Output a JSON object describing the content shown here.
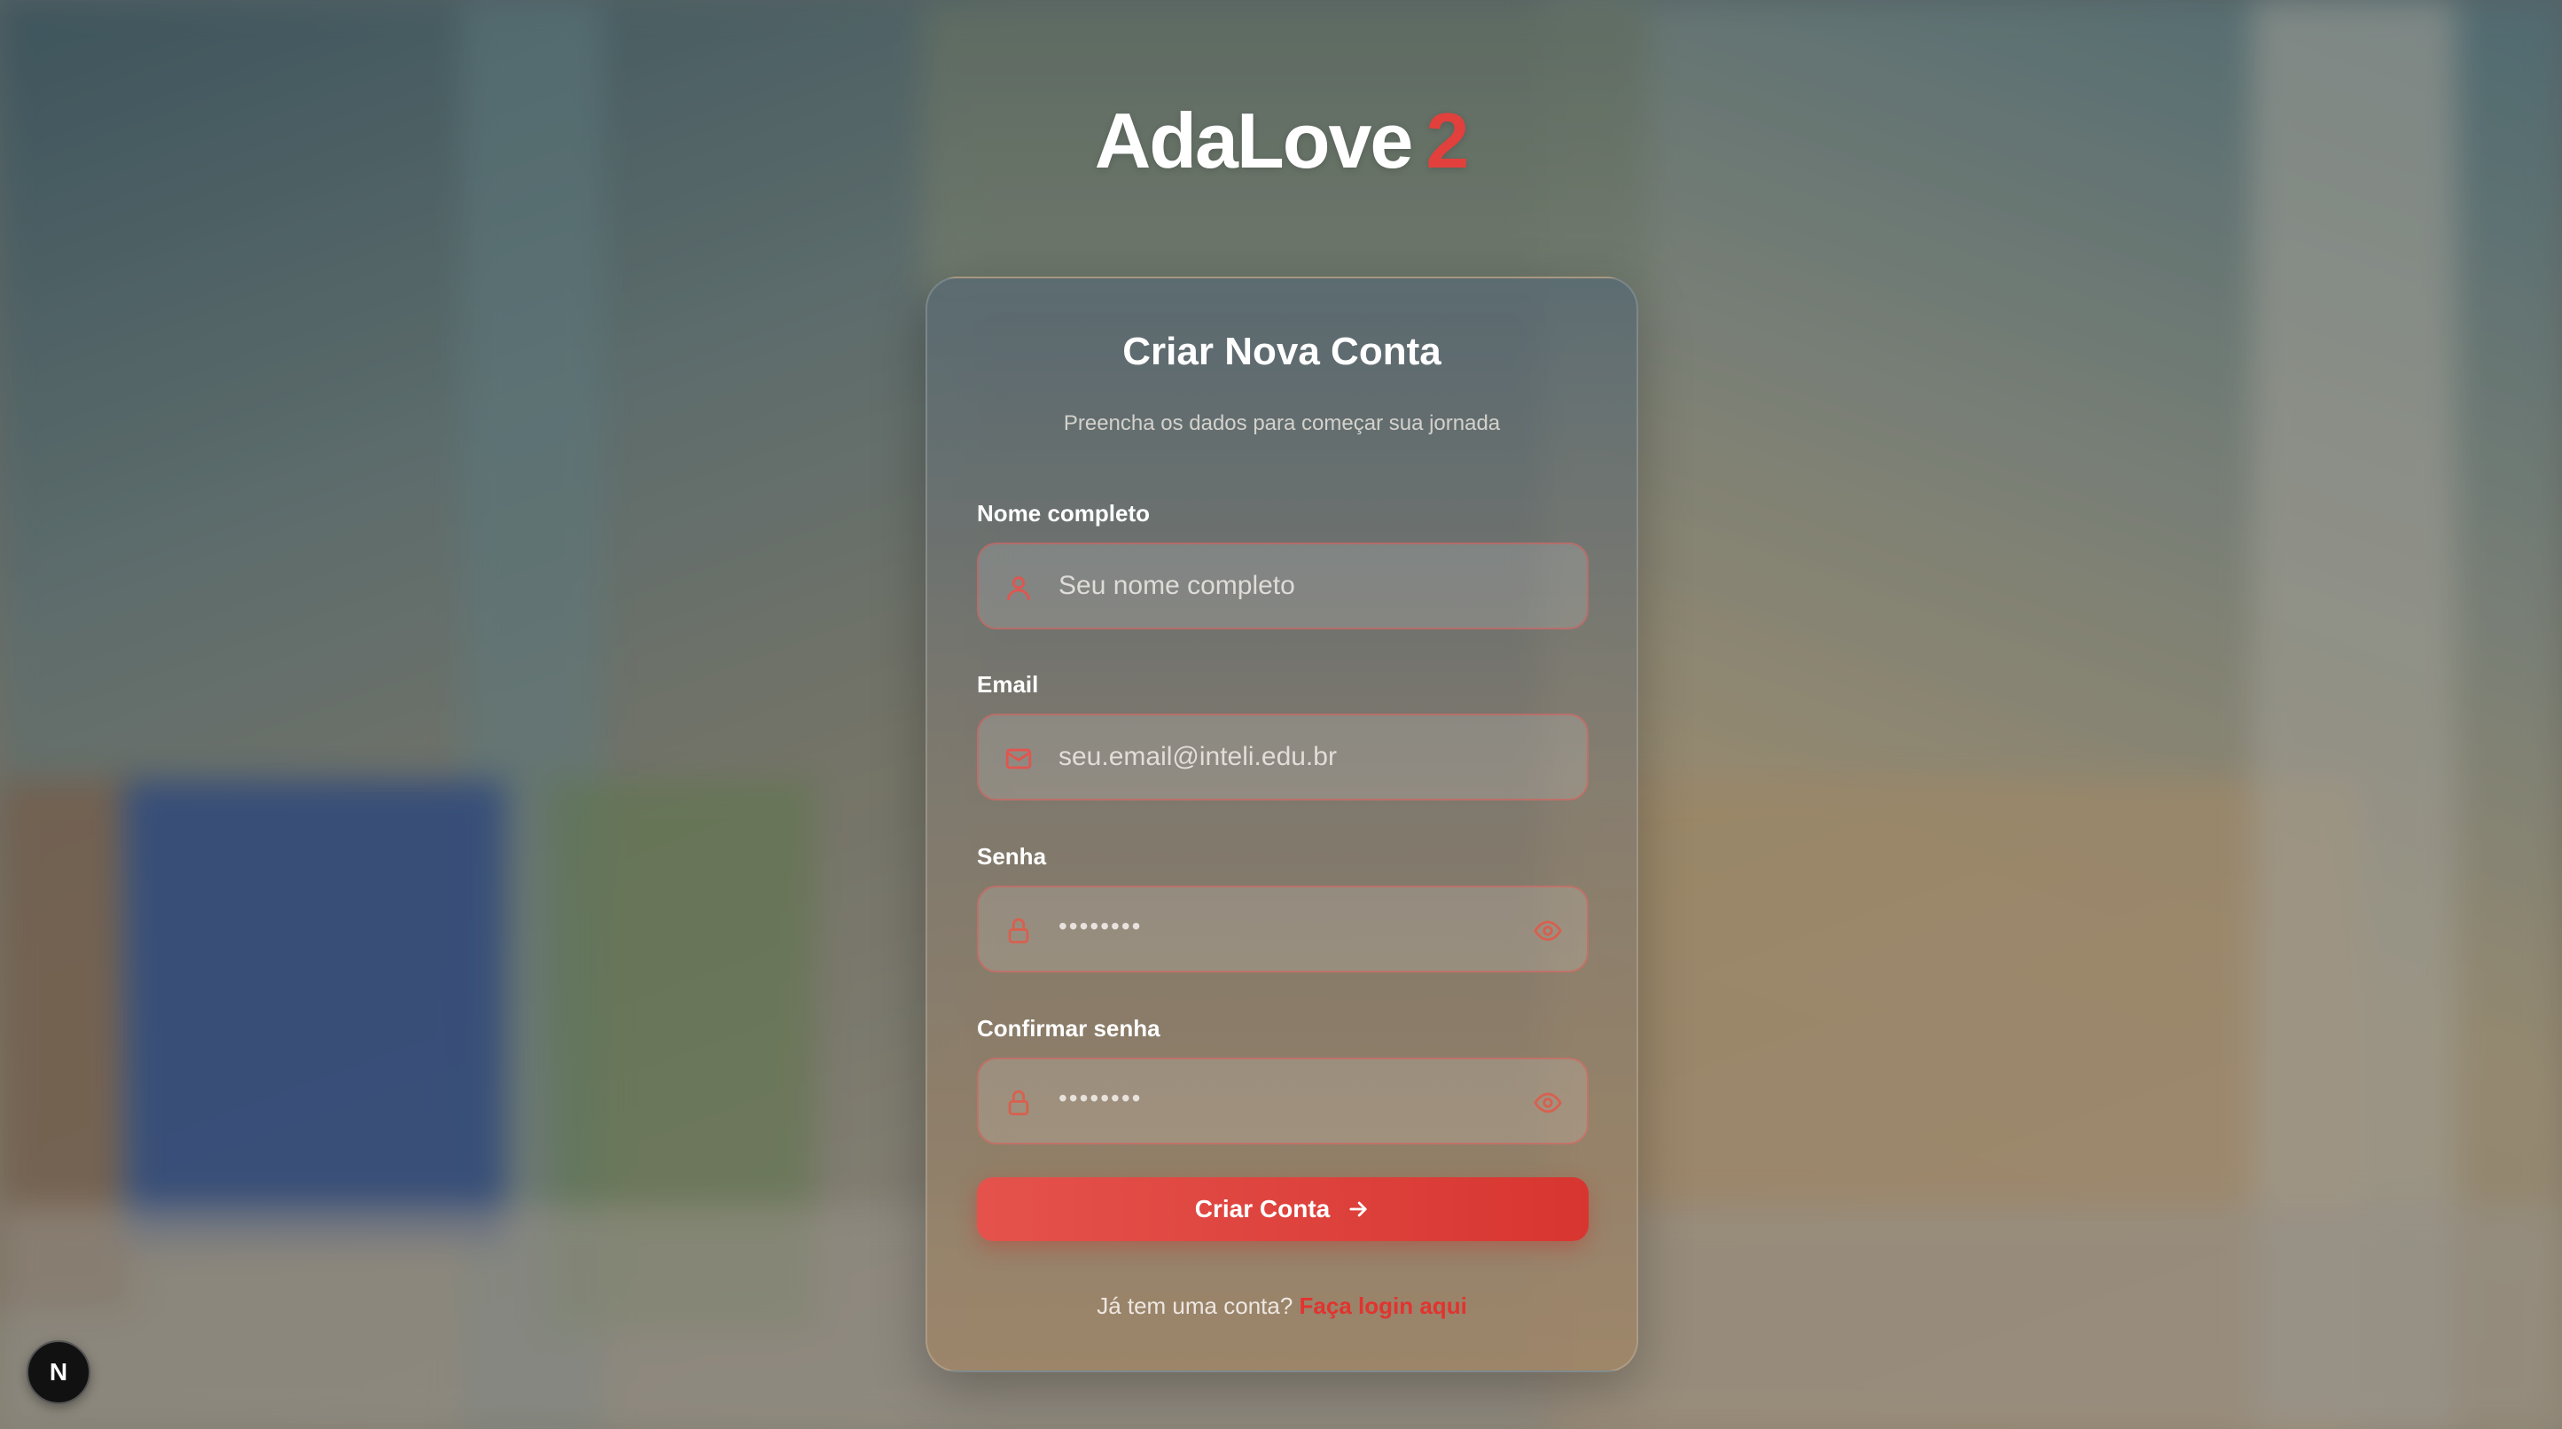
{
  "brand": {
    "name": "AdaLove",
    "version": "2"
  },
  "card": {
    "title": "Criar Nova Conta",
    "subtitle": "Preencha os dados para começar sua jornada"
  },
  "form": {
    "name": {
      "label": "Nome completo",
      "placeholder": "Seu nome completo",
      "icon": "user-icon"
    },
    "email": {
      "label": "Email",
      "placeholder": "seu.email@inteli.edu.br",
      "icon": "mail-icon"
    },
    "password": {
      "label": "Senha",
      "value": "••••••••",
      "icon": "lock-icon",
      "toggle_icon": "eye-icon"
    },
    "confirm_password": {
      "label": "Confirmar senha",
      "value": "••••••••",
      "icon": "lock-icon",
      "toggle_icon": "eye-icon"
    },
    "submit_label": "Criar Conta"
  },
  "footer": {
    "prompt": "Já tem uma conta?",
    "link": "Faça login aqui"
  },
  "dev_badge": {
    "letter": "N"
  },
  "colors": {
    "accent": "#e2403c",
    "link": "#e2332f",
    "button_start": "#e5524c",
    "button_end": "#d83530"
  }
}
